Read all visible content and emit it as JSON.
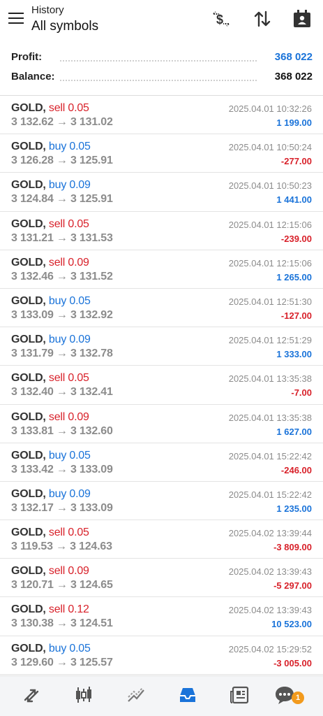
{
  "header": {
    "subtitle": "History",
    "title": "All symbols"
  },
  "summary": {
    "profit_label": "Profit:",
    "profit_value": "368 022",
    "balance_label": "Balance:",
    "balance_value": "368 022"
  },
  "colors": {
    "accent_blue": "#1a73d9",
    "sell_red": "#d8212a",
    "badge_orange": "#f29a1d"
  },
  "trades": [
    {
      "symbol": "GOLD,",
      "side": "sell",
      "volume": "sell 0.05",
      "prices": "3 132.62 → 3 131.02",
      "time": "2025.04.01 10:32:26",
      "profit": "1 199.00",
      "positive": true
    },
    {
      "symbol": "GOLD,",
      "side": "buy",
      "volume": "buy 0.05",
      "prices": "3 126.28 → 3 125.91",
      "time": "2025.04.01 10:50:24",
      "profit": "-277.00",
      "positive": false
    },
    {
      "symbol": "GOLD,",
      "side": "buy",
      "volume": "buy 0.09",
      "prices": "3 124.84 → 3 125.91",
      "time": "2025.04.01 10:50:23",
      "profit": "1 441.00",
      "positive": true
    },
    {
      "symbol": "GOLD,",
      "side": "sell",
      "volume": "sell 0.05",
      "prices": "3 131.21 → 3 131.53",
      "time": "2025.04.01 12:15:06",
      "profit": "-239.00",
      "positive": false
    },
    {
      "symbol": "GOLD,",
      "side": "sell",
      "volume": "sell 0.09",
      "prices": "3 132.46 → 3 131.52",
      "time": "2025.04.01 12:15:06",
      "profit": "1 265.00",
      "positive": true
    },
    {
      "symbol": "GOLD,",
      "side": "buy",
      "volume": "buy 0.05",
      "prices": "3 133.09 → 3 132.92",
      "time": "2025.04.01 12:51:30",
      "profit": "-127.00",
      "positive": false
    },
    {
      "symbol": "GOLD,",
      "side": "buy",
      "volume": "buy 0.09",
      "prices": "3 131.79 → 3 132.78",
      "time": "2025.04.01 12:51:29",
      "profit": "1 333.00",
      "positive": true
    },
    {
      "symbol": "GOLD,",
      "side": "sell",
      "volume": "sell 0.05",
      "prices": "3 132.40 → 3 132.41",
      "time": "2025.04.01 13:35:38",
      "profit": "-7.00",
      "positive": false
    },
    {
      "symbol": "GOLD,",
      "side": "sell",
      "volume": "sell 0.09",
      "prices": "3 133.81 → 3 132.60",
      "time": "2025.04.01 13:35:38",
      "profit": "1 627.00",
      "positive": true
    },
    {
      "symbol": "GOLD,",
      "side": "buy",
      "volume": "buy 0.05",
      "prices": "3 133.42 → 3 133.09",
      "time": "2025.04.01 15:22:42",
      "profit": "-246.00",
      "positive": false
    },
    {
      "symbol": "GOLD,",
      "side": "buy",
      "volume": "buy 0.09",
      "prices": "3 132.17 → 3 133.09",
      "time": "2025.04.01 15:22:42",
      "profit": "1 235.00",
      "positive": true
    },
    {
      "symbol": "GOLD,",
      "side": "sell",
      "volume": "sell 0.05",
      "prices": "3 119.53 → 3 124.63",
      "time": "2025.04.02 13:39:44",
      "profit": "-3 809.00",
      "positive": false
    },
    {
      "symbol": "GOLD,",
      "side": "sell",
      "volume": "sell 0.09",
      "prices": "3 120.71 → 3 124.65",
      "time": "2025.04.02 13:39:43",
      "profit": "-5 297.00",
      "positive": false
    },
    {
      "symbol": "GOLD,",
      "side": "sell",
      "volume": "sell 0.12",
      "prices": "3 130.38 → 3 124.51",
      "time": "2025.04.02 13:39:43",
      "profit": "10 523.00",
      "positive": true
    },
    {
      "symbol": "GOLD,",
      "side": "buy",
      "volume": "buy 0.05",
      "prices": "3 129.60 → 3 125.57",
      "time": "2025.04.02 15:29:52",
      "profit": "-3 005.00",
      "positive": false
    }
  ],
  "nav": {
    "items": [
      "quotes-icon",
      "chart-icon",
      "trade-icon",
      "history-icon",
      "news-icon",
      "messages-icon"
    ],
    "messages_badge": "1"
  }
}
